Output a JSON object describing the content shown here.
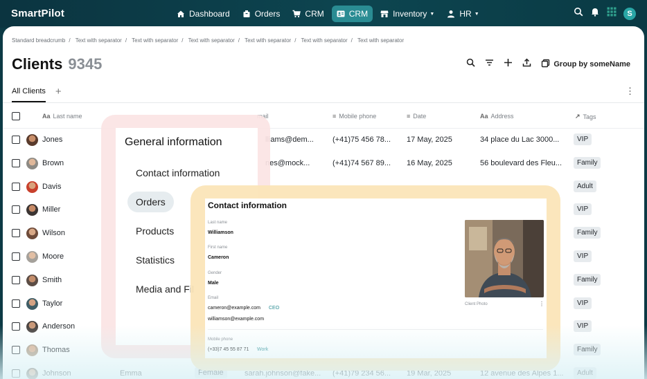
{
  "app": {
    "logo": "SmartPilot"
  },
  "nav": {
    "items": [
      {
        "label": "Dashboard",
        "icon": "home-icon"
      },
      {
        "label": "Orders",
        "icon": "box-icon"
      },
      {
        "label": "CRM",
        "icon": "cart-icon"
      },
      {
        "label": "CRM",
        "icon": "contact-card-icon",
        "active": true
      },
      {
        "label": "Inventory",
        "icon": "store-icon",
        "dropdown": true
      },
      {
        "label": "HR",
        "icon": "person-icon",
        "dropdown": true
      }
    ],
    "user_initial": "S"
  },
  "breadcrumb": [
    "Standard breadcrumb",
    "Text with separator",
    "Text with separator",
    "Text with separator",
    "Text with separator",
    "Text with separator",
    "Text with separator"
  ],
  "page": {
    "title": "Clients",
    "count": "9345",
    "group_by": "Group by someName"
  },
  "tabs": {
    "active": "All Clients"
  },
  "table": {
    "columns": [
      "Last name",
      "mail",
      "Mobile phone",
      "Date",
      "Address",
      "Tags"
    ],
    "rows": [
      {
        "last": "Jones",
        "email": "lliams@dem...",
        "phone": "(+41)75 456 78...",
        "date": "17 May, 2025",
        "address": "34 place du Lac 3000...",
        "tag": "VIP"
      },
      {
        "last": "Brown",
        "email": "nes@mock...",
        "phone": "(+41)74 567 89...",
        "date": "16 May, 2025",
        "address": "56 boulevard des Fleu...",
        "tag": "Family"
      },
      {
        "last": "Davis",
        "tag": "Adult"
      },
      {
        "last": "Miller",
        "tag": "VIP"
      },
      {
        "last": "Wilson",
        "tag": "Family"
      },
      {
        "last": "Moore",
        "tag": "VIP"
      },
      {
        "last": "Smith",
        "tag": "Family"
      },
      {
        "last": "Taylor",
        "tag": "VIP"
      },
      {
        "last": "Anderson",
        "tag": "VIP"
      },
      {
        "last": "Thomas",
        "tag": "Family"
      },
      {
        "last": "Johnson",
        "first": "Emma",
        "gender": "Female",
        "email": "sarah.johnson@fake...",
        "phone": "(+41)79 234 56...",
        "date": "19 Mar, 2025",
        "address": "12 avenue des Alpes 1...",
        "tag": "Adult"
      }
    ]
  },
  "general_panel": {
    "title": "General information",
    "items": [
      "Contact information",
      "Orders",
      "Products",
      "Statistics",
      "Media and Fil"
    ],
    "active_index": 1
  },
  "contact_panel": {
    "title": "Contact information",
    "last_name_label": "Last name",
    "last_name": "Williamson",
    "first_name_label": "First name",
    "first_name": "Cameron",
    "gender_label": "Gender",
    "gender": "Male",
    "email_label": "Email",
    "email1": "cameron@example.com",
    "email1_role": "CEO",
    "email2": "williamson@example.com",
    "phone_label": "Mobile phone",
    "phone": "(+33)7 45 55 87 71",
    "phone_type": "Work",
    "photo_caption": "Client Photo"
  }
}
